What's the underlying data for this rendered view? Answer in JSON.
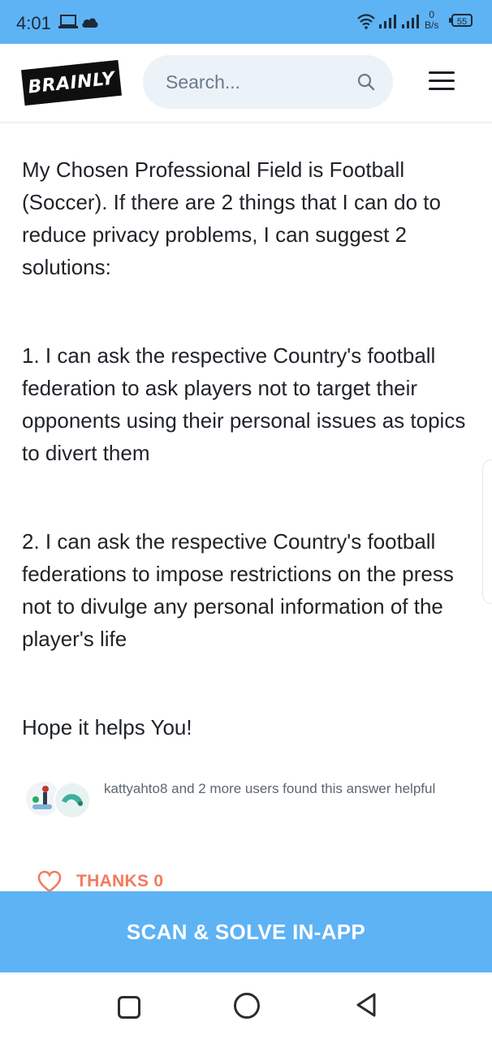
{
  "status_bar": {
    "time": "4:01",
    "net_speed_value": "0",
    "net_speed_unit": "B/s",
    "battery": "55",
    "icons": [
      "laptop-icon",
      "cloud-icon",
      "wifi-icon",
      "signal-icon",
      "signal-icon"
    ]
  },
  "header": {
    "logo_text": "BRAINLY",
    "search_placeholder": "Search...",
    "icons": [
      "search-icon",
      "menu-icon"
    ]
  },
  "answer": {
    "paragraphs": [
      "My Chosen Professional Field is Football (Soccer). If there are 2 things that I can do to reduce privacy problems, I can suggest 2 solutions:",
      "1. I can ask the respective Country's football federation to ask players not to target their opponents using their personal issues as topics to divert them",
      "2. I can ask the respective Country's football federations to impose restrictions on the press not to divulge any personal information of the player's life",
      "Hope it helps You!"
    ]
  },
  "helpful": {
    "text": "kattyahto8 and 2 more users found this answer helpful"
  },
  "thanks": {
    "label": "THANKS 0",
    "icon": "heart-icon"
  },
  "cta": {
    "label": "SCAN & SOLVE IN-APP"
  },
  "colors": {
    "brand_blue": "#5eb3f5",
    "thanks_coral": "#f47a5e",
    "search_bg": "#ebf2f8"
  }
}
